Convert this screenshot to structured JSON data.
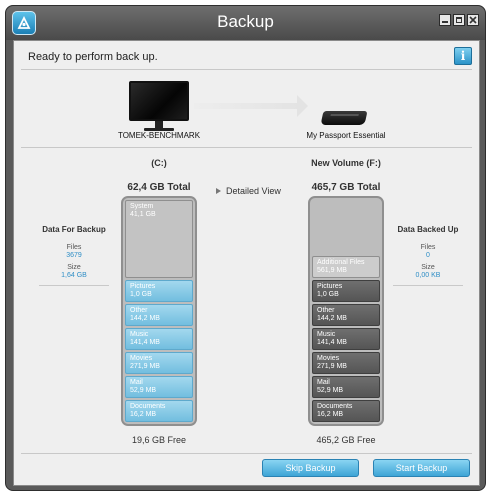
{
  "window": {
    "title": "Backup"
  },
  "status": {
    "message": "Ready to perform back up."
  },
  "source": {
    "device_name": "TOMEK-BENCHMARK",
    "volume": "(C:)",
    "total": "62,4 GB Total",
    "free": "19,6 GB Free",
    "system": {
      "label": "System",
      "size": "41,1 GB"
    },
    "categories": [
      {
        "label": "Pictures",
        "size": "1,0 GB"
      },
      {
        "label": "Other",
        "size": "144,2 MB"
      },
      {
        "label": "Music",
        "size": "141,4 MB"
      },
      {
        "label": "Movies",
        "size": "271,9 MB"
      },
      {
        "label": "Mail",
        "size": "52,9 MB"
      },
      {
        "label": "Documents",
        "size": "16,2 MB"
      }
    ]
  },
  "destination": {
    "device_name": "My Passport Essential",
    "volume": "New Volume (F:)",
    "total": "465,7 GB Total",
    "free": "465,2 GB Free",
    "additional": {
      "label": "Additional Files",
      "size": "561,9 MB"
    },
    "categories": [
      {
        "label": "Pictures",
        "size": "1,0 GB"
      },
      {
        "label": "Other",
        "size": "144,2 MB"
      },
      {
        "label": "Music",
        "size": "141,4 MB"
      },
      {
        "label": "Movies",
        "size": "271,9 MB"
      },
      {
        "label": "Mail",
        "size": "52,9 MB"
      },
      {
        "label": "Documents",
        "size": "16,2 MB"
      }
    ]
  },
  "detailed_view": "Detailed View",
  "data_for_backup": {
    "heading": "Data For Backup",
    "files_label": "Files",
    "files": "3679",
    "size_label": "Size",
    "size": "1,64 GB"
  },
  "data_backed_up": {
    "heading": "Data Backed Up",
    "files_label": "Files",
    "files": "0",
    "size_label": "Size",
    "size": "0,00 KB"
  },
  "buttons": {
    "skip": "Skip Backup",
    "start": "Start Backup"
  },
  "icons": {
    "app": "wd-app-icon",
    "info": "info-icon"
  },
  "colors": {
    "accent": "#3ea4d6",
    "backup_segment": "#72bedf",
    "backed_up_segment": "#5a5a5a"
  }
}
